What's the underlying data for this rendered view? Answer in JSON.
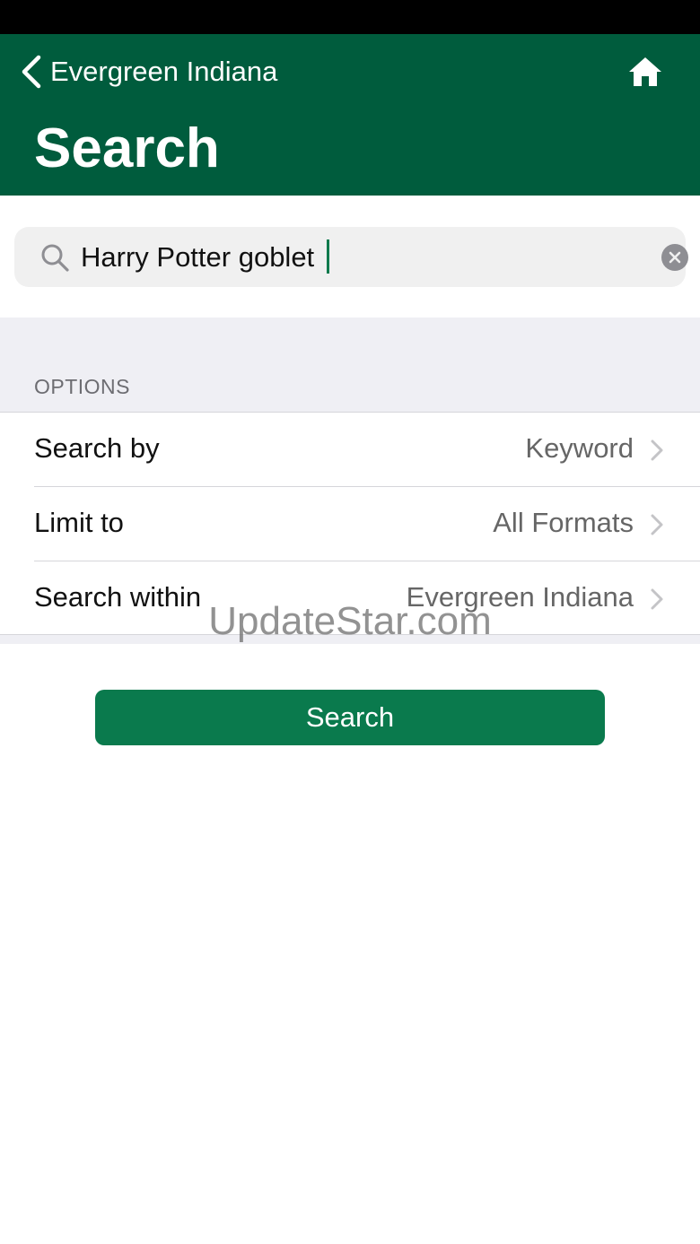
{
  "header": {
    "back_label": "Evergreen Indiana",
    "title": "Search",
    "icons": {
      "back": "chevron-left-icon",
      "home": "home-icon"
    },
    "background_color": "#005c3d"
  },
  "search": {
    "value": "Harry Potter goblet",
    "icons": {
      "search": "magnifier-icon",
      "clear": "clear-circle-icon"
    }
  },
  "options": {
    "header": "OPTIONS",
    "rows": [
      {
        "label": "Search by",
        "value": "Keyword"
      },
      {
        "label": "Limit to",
        "value": "All Formats"
      },
      {
        "label": "Search within",
        "value": "Evergreen Indiana"
      }
    ]
  },
  "watermark": "UpdateStar.com",
  "submit": {
    "label": "Search",
    "color": "#0a7a4d"
  }
}
